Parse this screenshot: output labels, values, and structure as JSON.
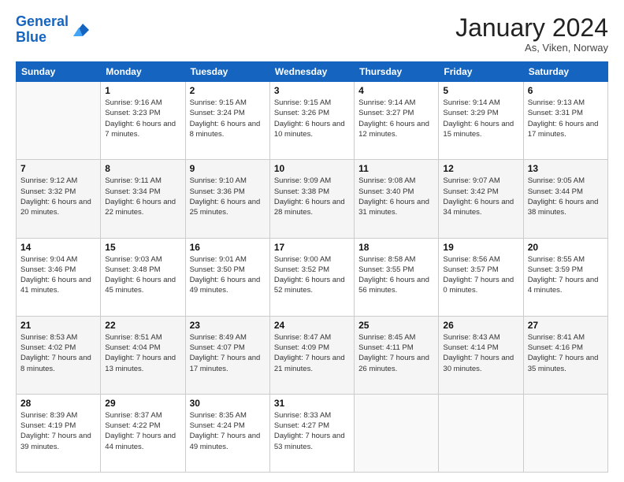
{
  "header": {
    "logo_line1": "General",
    "logo_line2": "Blue",
    "month_title": "January 2024",
    "location": "As, Viken, Norway"
  },
  "weekdays": [
    "Sunday",
    "Monday",
    "Tuesday",
    "Wednesday",
    "Thursday",
    "Friday",
    "Saturday"
  ],
  "weeks": [
    [
      {
        "day": "",
        "sunrise": "",
        "sunset": "",
        "daylight": ""
      },
      {
        "day": "1",
        "sunrise": "Sunrise: 9:16 AM",
        "sunset": "Sunset: 3:23 PM",
        "daylight": "Daylight: 6 hours and 7 minutes."
      },
      {
        "day": "2",
        "sunrise": "Sunrise: 9:15 AM",
        "sunset": "Sunset: 3:24 PM",
        "daylight": "Daylight: 6 hours and 8 minutes."
      },
      {
        "day": "3",
        "sunrise": "Sunrise: 9:15 AM",
        "sunset": "Sunset: 3:26 PM",
        "daylight": "Daylight: 6 hours and 10 minutes."
      },
      {
        "day": "4",
        "sunrise": "Sunrise: 9:14 AM",
        "sunset": "Sunset: 3:27 PM",
        "daylight": "Daylight: 6 hours and 12 minutes."
      },
      {
        "day": "5",
        "sunrise": "Sunrise: 9:14 AM",
        "sunset": "Sunset: 3:29 PM",
        "daylight": "Daylight: 6 hours and 15 minutes."
      },
      {
        "day": "6",
        "sunrise": "Sunrise: 9:13 AM",
        "sunset": "Sunset: 3:31 PM",
        "daylight": "Daylight: 6 hours and 17 minutes."
      }
    ],
    [
      {
        "day": "7",
        "sunrise": "Sunrise: 9:12 AM",
        "sunset": "Sunset: 3:32 PM",
        "daylight": "Daylight: 6 hours and 20 minutes."
      },
      {
        "day": "8",
        "sunrise": "Sunrise: 9:11 AM",
        "sunset": "Sunset: 3:34 PM",
        "daylight": "Daylight: 6 hours and 22 minutes."
      },
      {
        "day": "9",
        "sunrise": "Sunrise: 9:10 AM",
        "sunset": "Sunset: 3:36 PM",
        "daylight": "Daylight: 6 hours and 25 minutes."
      },
      {
        "day": "10",
        "sunrise": "Sunrise: 9:09 AM",
        "sunset": "Sunset: 3:38 PM",
        "daylight": "Daylight: 6 hours and 28 minutes."
      },
      {
        "day": "11",
        "sunrise": "Sunrise: 9:08 AM",
        "sunset": "Sunset: 3:40 PM",
        "daylight": "Daylight: 6 hours and 31 minutes."
      },
      {
        "day": "12",
        "sunrise": "Sunrise: 9:07 AM",
        "sunset": "Sunset: 3:42 PM",
        "daylight": "Daylight: 6 hours and 34 minutes."
      },
      {
        "day": "13",
        "sunrise": "Sunrise: 9:05 AM",
        "sunset": "Sunset: 3:44 PM",
        "daylight": "Daylight: 6 hours and 38 minutes."
      }
    ],
    [
      {
        "day": "14",
        "sunrise": "Sunrise: 9:04 AM",
        "sunset": "Sunset: 3:46 PM",
        "daylight": "Daylight: 6 hours and 41 minutes."
      },
      {
        "day": "15",
        "sunrise": "Sunrise: 9:03 AM",
        "sunset": "Sunset: 3:48 PM",
        "daylight": "Daylight: 6 hours and 45 minutes."
      },
      {
        "day": "16",
        "sunrise": "Sunrise: 9:01 AM",
        "sunset": "Sunset: 3:50 PM",
        "daylight": "Daylight: 6 hours and 49 minutes."
      },
      {
        "day": "17",
        "sunrise": "Sunrise: 9:00 AM",
        "sunset": "Sunset: 3:52 PM",
        "daylight": "Daylight: 6 hours and 52 minutes."
      },
      {
        "day": "18",
        "sunrise": "Sunrise: 8:58 AM",
        "sunset": "Sunset: 3:55 PM",
        "daylight": "Daylight: 6 hours and 56 minutes."
      },
      {
        "day": "19",
        "sunrise": "Sunrise: 8:56 AM",
        "sunset": "Sunset: 3:57 PM",
        "daylight": "Daylight: 7 hours and 0 minutes."
      },
      {
        "day": "20",
        "sunrise": "Sunrise: 8:55 AM",
        "sunset": "Sunset: 3:59 PM",
        "daylight": "Daylight: 7 hours and 4 minutes."
      }
    ],
    [
      {
        "day": "21",
        "sunrise": "Sunrise: 8:53 AM",
        "sunset": "Sunset: 4:02 PM",
        "daylight": "Daylight: 7 hours and 8 minutes."
      },
      {
        "day": "22",
        "sunrise": "Sunrise: 8:51 AM",
        "sunset": "Sunset: 4:04 PM",
        "daylight": "Daylight: 7 hours and 13 minutes."
      },
      {
        "day": "23",
        "sunrise": "Sunrise: 8:49 AM",
        "sunset": "Sunset: 4:07 PM",
        "daylight": "Daylight: 7 hours and 17 minutes."
      },
      {
        "day": "24",
        "sunrise": "Sunrise: 8:47 AM",
        "sunset": "Sunset: 4:09 PM",
        "daylight": "Daylight: 7 hours and 21 minutes."
      },
      {
        "day": "25",
        "sunrise": "Sunrise: 8:45 AM",
        "sunset": "Sunset: 4:11 PM",
        "daylight": "Daylight: 7 hours and 26 minutes."
      },
      {
        "day": "26",
        "sunrise": "Sunrise: 8:43 AM",
        "sunset": "Sunset: 4:14 PM",
        "daylight": "Daylight: 7 hours and 30 minutes."
      },
      {
        "day": "27",
        "sunrise": "Sunrise: 8:41 AM",
        "sunset": "Sunset: 4:16 PM",
        "daylight": "Daylight: 7 hours and 35 minutes."
      }
    ],
    [
      {
        "day": "28",
        "sunrise": "Sunrise: 8:39 AM",
        "sunset": "Sunset: 4:19 PM",
        "daylight": "Daylight: 7 hours and 39 minutes."
      },
      {
        "day": "29",
        "sunrise": "Sunrise: 8:37 AM",
        "sunset": "Sunset: 4:22 PM",
        "daylight": "Daylight: 7 hours and 44 minutes."
      },
      {
        "day": "30",
        "sunrise": "Sunrise: 8:35 AM",
        "sunset": "Sunset: 4:24 PM",
        "daylight": "Daylight: 7 hours and 49 minutes."
      },
      {
        "day": "31",
        "sunrise": "Sunrise: 8:33 AM",
        "sunset": "Sunset: 4:27 PM",
        "daylight": "Daylight: 7 hours and 53 minutes."
      },
      {
        "day": "",
        "sunrise": "",
        "sunset": "",
        "daylight": ""
      },
      {
        "day": "",
        "sunrise": "",
        "sunset": "",
        "daylight": ""
      },
      {
        "day": "",
        "sunrise": "",
        "sunset": "",
        "daylight": ""
      }
    ]
  ]
}
